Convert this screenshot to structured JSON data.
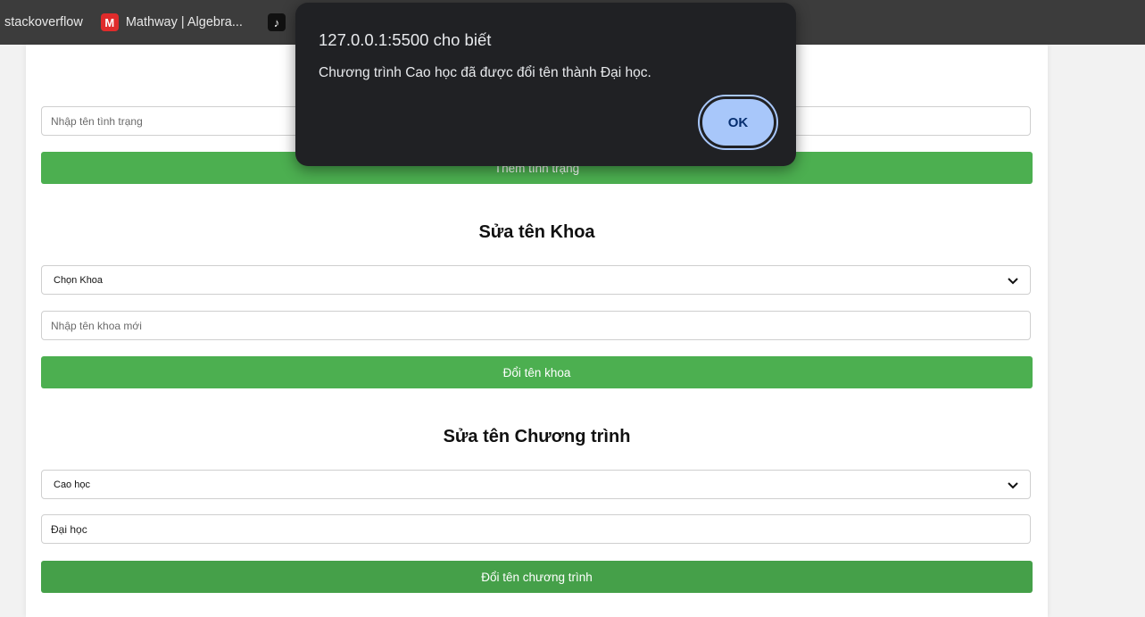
{
  "bookmarks": [
    {
      "label": "stackoverflow",
      "icon": ""
    },
    {
      "label": "Mathway | Algebra...",
      "icon": "mathway-icon"
    },
    {
      "label": "",
      "icon": "tiktok-icon"
    }
  ],
  "status_form": {
    "input_placeholder": "Nhập tên tình trạng",
    "button_label": "Thêm tình trạng"
  },
  "faculty_form": {
    "title": "Sửa tên Khoa",
    "select_value": "Chọn Khoa",
    "input_placeholder": "Nhập tên khoa mới",
    "button_label": "Đổi tên khoa"
  },
  "program_form": {
    "title": "Sửa tên Chương trình",
    "select_value": "Cao học",
    "input_value": "Đại học",
    "button_label": "Đổi tên chương trình"
  },
  "dialog": {
    "title": "127.0.0.1:5500 cho biết",
    "message": "Chương trình Cao học đã được đổi tên thành Đại học.",
    "ok_label": "OK"
  },
  "colors": {
    "button_green": "#4caf50",
    "dialog_bg": "#202124",
    "ok_button": "#a8c7fa"
  }
}
